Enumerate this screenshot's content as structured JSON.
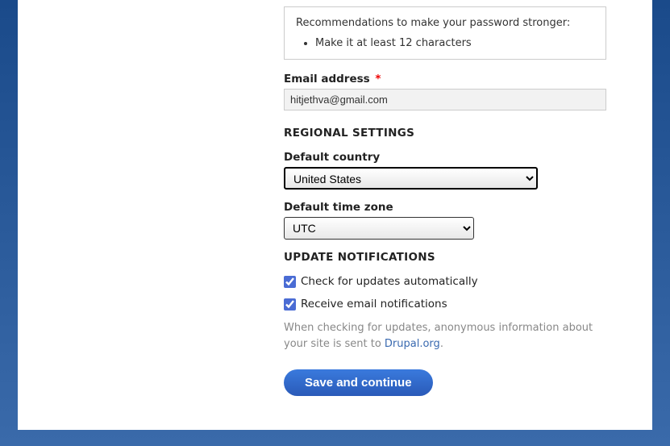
{
  "password_recommendation": {
    "heading": "Recommendations to make your password stronger:",
    "items": [
      "Make it at least 12 characters"
    ]
  },
  "email": {
    "label": "Email address",
    "required_mark": "*",
    "value": "hitjethva@gmail.com"
  },
  "regional": {
    "heading": "REGIONAL SETTINGS",
    "country_label": "Default country",
    "country_value": "United States",
    "timezone_label": "Default time zone",
    "timezone_value": "UTC"
  },
  "updates": {
    "heading": "UPDATE NOTIFICATIONS",
    "check_updates_label": "Check for updates automatically",
    "receive_email_label": "Receive email notifications",
    "help_text_prefix": "When checking for updates, anonymous information about your site is sent to ",
    "help_link_text": "Drupal.org",
    "help_text_suffix": "."
  },
  "save_button": "Save and continue"
}
